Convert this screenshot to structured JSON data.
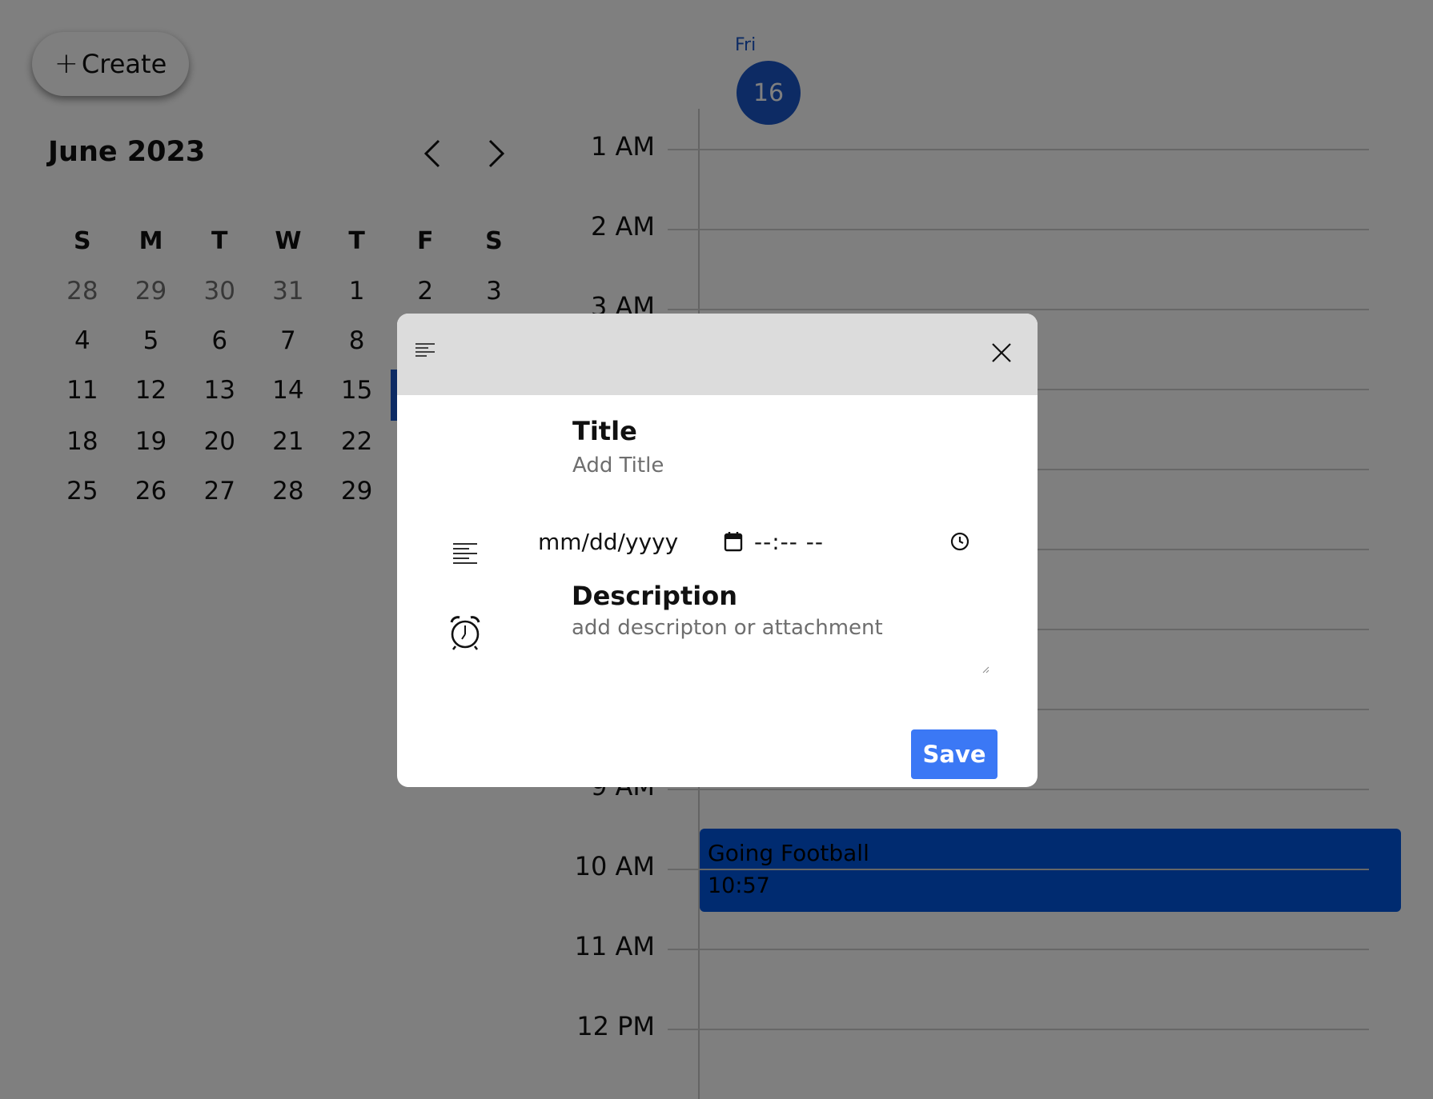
{
  "create_button": {
    "icon": "plus-icon",
    "label": "Create"
  },
  "mini_calendar": {
    "month_label": "June 2023",
    "prev_icon": "chevron-left-icon",
    "next_icon": "chevron-right-icon",
    "weekdays": [
      "S",
      "M",
      "T",
      "W",
      "T",
      "F",
      "S"
    ],
    "weeks": [
      [
        "28",
        "29",
        "30",
        "31",
        "1",
        "2",
        "3"
      ],
      [
        "4",
        "5",
        "6",
        "7",
        "8",
        "",
        ""
      ],
      [
        "11",
        "12",
        "13",
        "14",
        "15",
        "",
        ""
      ],
      [
        "18",
        "19",
        "20",
        "21",
        "22",
        "",
        ""
      ],
      [
        "25",
        "26",
        "27",
        "28",
        "29",
        "",
        ""
      ]
    ],
    "selected_date": "16"
  },
  "day_view": {
    "day_name": "Fri",
    "day_number": "16",
    "hours": [
      "1 AM",
      "2 AM",
      "3 AM",
      "",
      "",
      "",
      "",
      "",
      "9 AM",
      "10 AM",
      "11 AM",
      "12 PM"
    ],
    "event": {
      "title": "Going Football",
      "time": "10:57"
    }
  },
  "modal": {
    "header_icon": "notes-icon",
    "close_icon": "close-icon",
    "title_label": "Title",
    "title_placeholder": "Add Title",
    "date_value": "mm/dd/yyyy",
    "date_icon": "calendar-icon",
    "time_value": "--:-- --",
    "time_icon": "clock-icon",
    "description_icon": "text-align-icon",
    "alarm_icon": "alarm-clock-icon",
    "description_label": "Description",
    "description_placeholder": "add descripton or attachment",
    "save_label": "Save"
  },
  "colors": {
    "accent": "#1a56c8",
    "event_background": "#0057e0",
    "save_button": "#3b78f5",
    "overlay": "#808080"
  }
}
